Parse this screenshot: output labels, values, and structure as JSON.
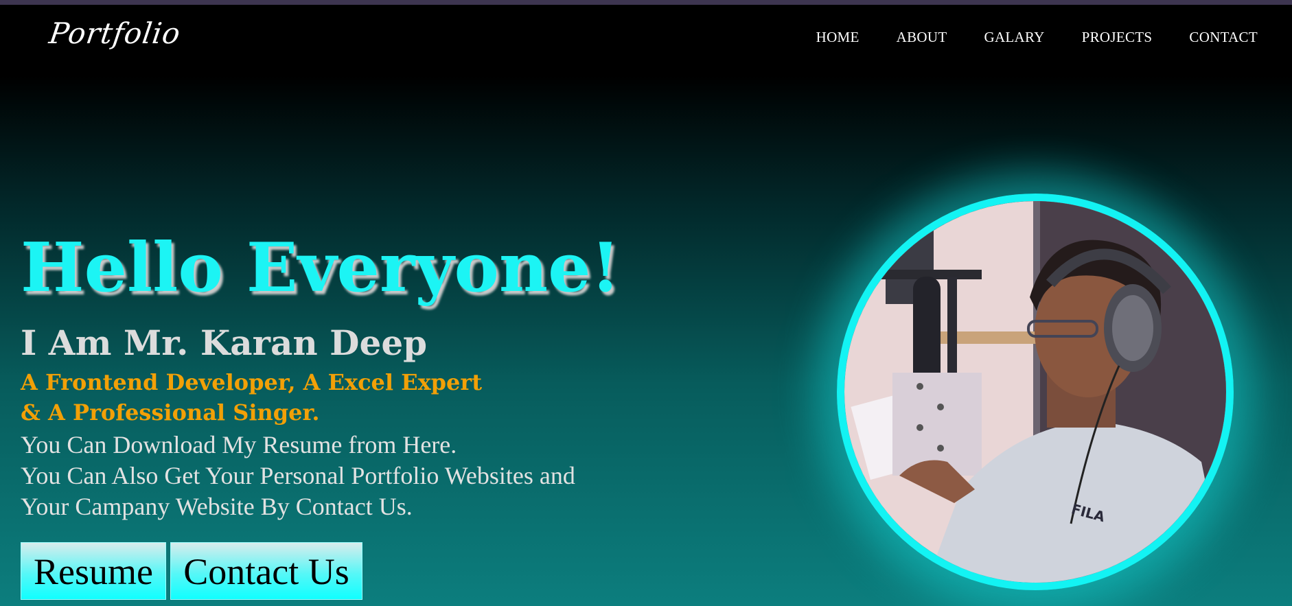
{
  "header": {
    "logo": "Portfolio",
    "nav": [
      "HOME",
      "ABOUT",
      "GALARY",
      "PROJECTS",
      "CONTACT"
    ]
  },
  "hero": {
    "title": "Hello Everyone!",
    "name": "I Am Mr. Karan Deep",
    "role_line1": "A Frontend Developer, A Excel Expert",
    "role_line2": "& A Professional Singer.",
    "desc_line1": "You Can Download My Resume from Here.",
    "desc_line2": "You Can Also Get Your Personal Portfolio Websites and",
    "desc_line3": "Your Campany Website By Contact Us.",
    "resume_button": "Resume",
    "contact_button": "Contact Us"
  },
  "photo": {
    "shirt_logo": "FILA"
  },
  "colors": {
    "accent_cyan": "#13f3f3",
    "role_orange": "#f2a007",
    "name_gray": "#dcdcdc"
  }
}
